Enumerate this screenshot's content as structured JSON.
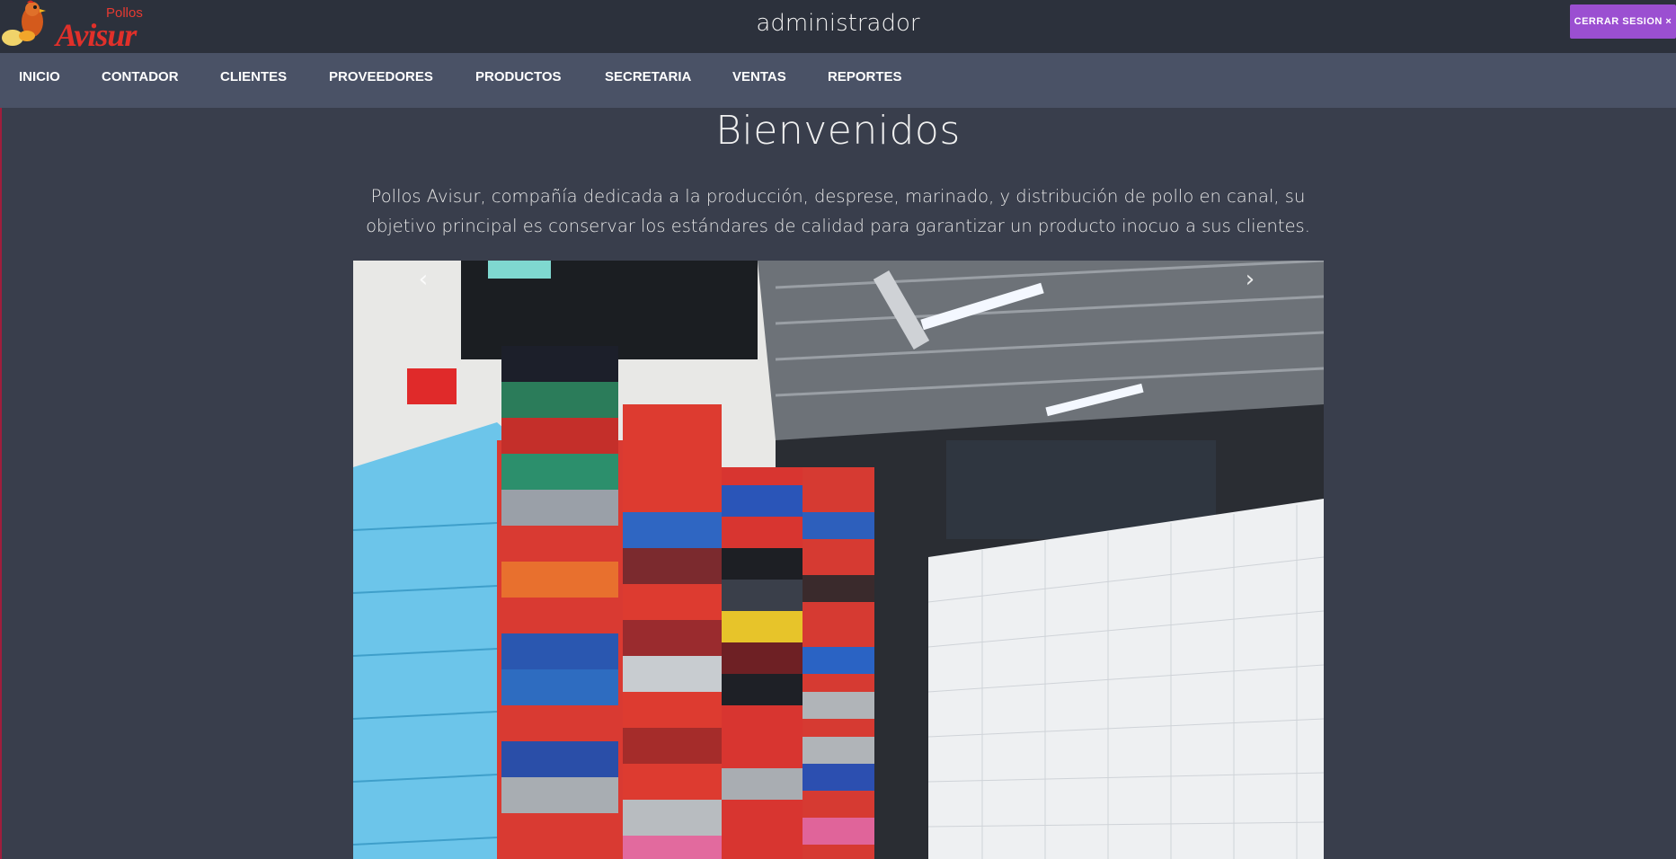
{
  "header": {
    "logo_small_text": "Pollos",
    "logo_brand_text": "Avisur",
    "title": "administrador",
    "logout_label": "CERRAR SESION ×"
  },
  "nav": {
    "items": [
      {
        "label": "INICIO"
      },
      {
        "label": "CONTADOR"
      },
      {
        "label": "CLIENTES"
      },
      {
        "label": "PROVEEDORES"
      },
      {
        "label": "PRODUCTOS"
      },
      {
        "label": "SECRETARIA"
      },
      {
        "label": "VENTAS"
      },
      {
        "label": "REPORTES"
      }
    ]
  },
  "main": {
    "heading": "Bienvenidos",
    "intro": "Pollos Avisur, compañía dedicada a la producción, desprese, marinado, y distribución de pollo en canal, su objetivo principal es conservar los estándares de calidad para garantizar un producto inocuo a sus clientes."
  },
  "carousel": {
    "prev_icon": "chevron-left-icon",
    "next_icon": "chevron-right-icon",
    "prev_glyph": "‹",
    "next_glyph": "›"
  },
  "colors": {
    "topbar": "#2c313c",
    "navbar": "#4a5266",
    "page": "#393e4c",
    "logout": "#9b4fd1",
    "brand_red": "#e0302a"
  }
}
